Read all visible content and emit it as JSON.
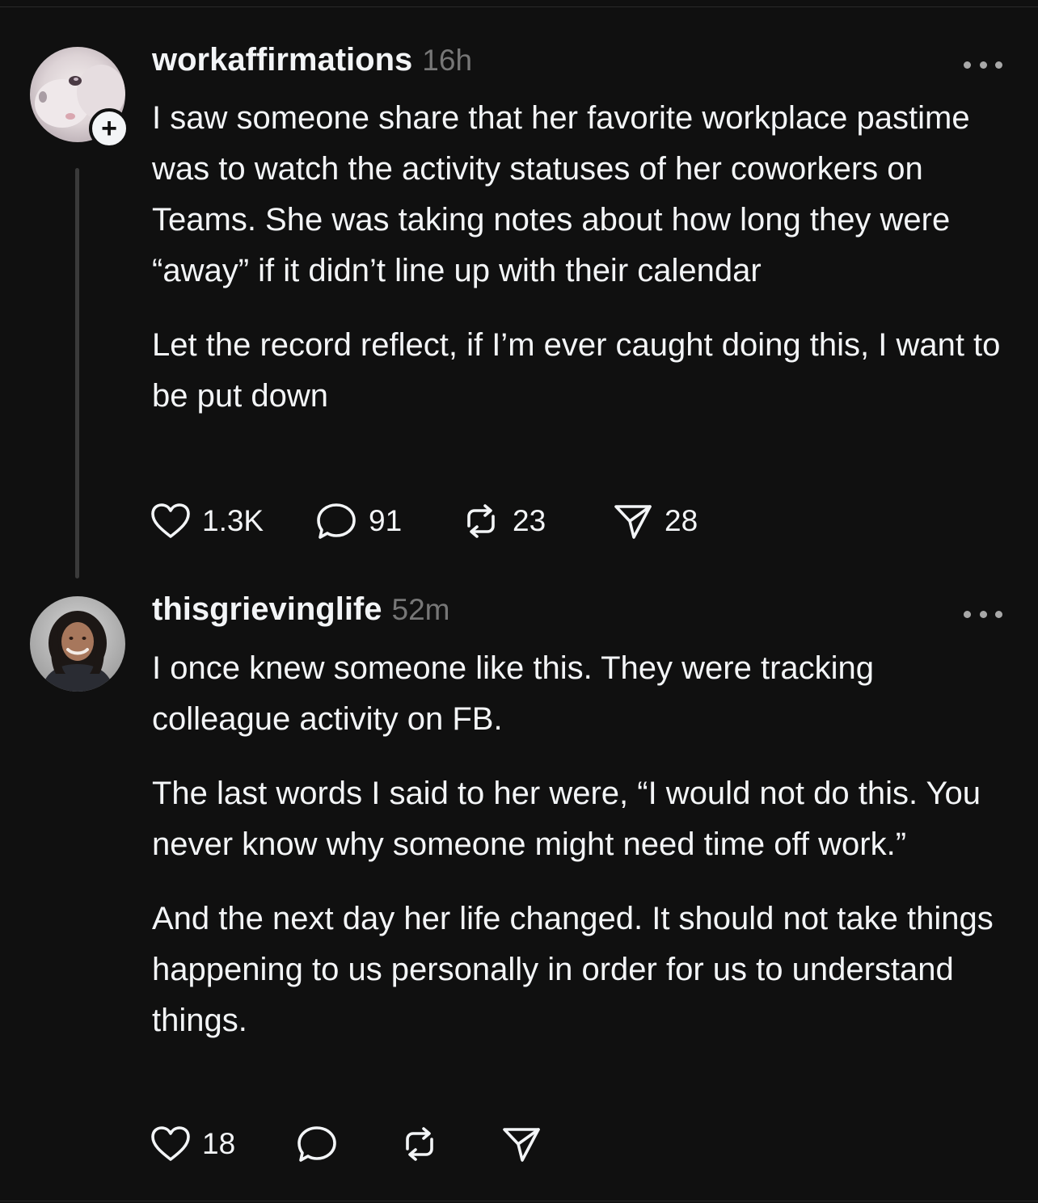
{
  "posts": [
    {
      "username": "workaffirmations",
      "timestamp": "16h",
      "avatar_icon": "avatar-cat-icon",
      "follow_icon": "plus-icon",
      "paragraphs": [
        "I saw someone share that her favorite workplace pastime was to watch the activity statuses of her coworkers on Teams. She was taking notes about how long they were “away” if it didn’t line up with their calendar",
        "Let the record reflect, if I’m ever caught doing this, I want to be put down"
      ],
      "actions": {
        "likes": "1.3K",
        "replies": "91",
        "reposts": "23",
        "shares": "28"
      }
    },
    {
      "username": "thisgrievinglife",
      "timestamp": "52m",
      "avatar_icon": "avatar-person-icon",
      "paragraphs": [
        "I once knew someone like this. They were tracking colleague activity on FB.",
        "The last words I said to her were, “I would not do this.  You never know why someone might need time off work.”",
        "And the next day her life changed.  It should not take things happening to us personally in order for us to understand things."
      ],
      "actions": {
        "likes": "18",
        "replies": "",
        "reposts": "",
        "shares": ""
      }
    }
  ],
  "colors": {
    "background": "#101010",
    "text": "#f3f5f7",
    "muted": "#777777",
    "thread_line": "#3a3a3a"
  }
}
